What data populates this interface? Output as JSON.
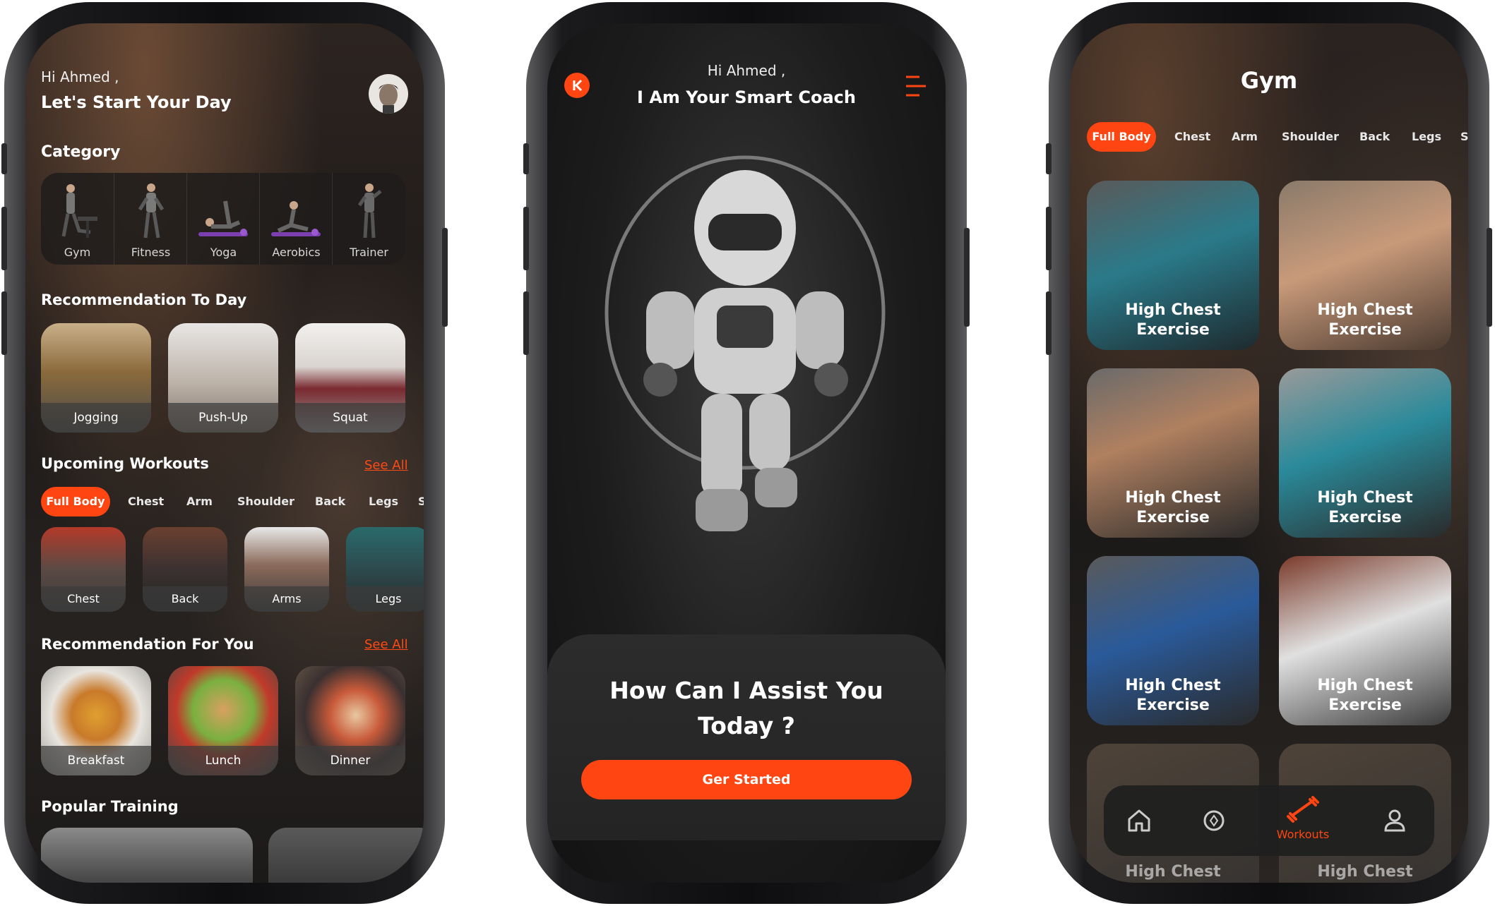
{
  "home": {
    "greeting": "Hi Ahmed ,",
    "subtitle": "Let's Start Your Day",
    "category_title": "Category",
    "categories": [
      {
        "label": "Gym",
        "icon": "gym-figure-icon"
      },
      {
        "label": "Fitness",
        "icon": "fitness-figure-icon"
      },
      {
        "label": "Yoga",
        "icon": "yoga-figure-icon"
      },
      {
        "label": "Aerobics",
        "icon": "aerobics-figure-icon"
      },
      {
        "label": "Trainer",
        "icon": "trainer-figure-icon"
      }
    ],
    "recommendation_today_title": "Recommendation To Day",
    "recommendations_today": [
      "Jogging",
      "Push-Up",
      "Squat"
    ],
    "upcoming_title": "Upcoming Workouts",
    "see_all": "See All",
    "tabs": [
      "Full Body",
      "Chest",
      "Arm",
      "Shoulder",
      "Back",
      "Legs",
      "S"
    ],
    "active_tab": "Full Body",
    "workouts": [
      "Chest",
      "Back",
      "Arms",
      "Legs"
    ],
    "recommendation_you_title": "Recommendation For You",
    "meals": [
      "Breakfast",
      "Lunch",
      "Dinner"
    ],
    "popular_title": "Popular Training"
  },
  "coach": {
    "greeting": "Hi Ahmed ,",
    "title": "I Am Your Smart Coach",
    "assist_line1": "How Can I Assist You",
    "assist_line2": "Today ?",
    "cta": "Ger Started"
  },
  "gym": {
    "title": "Gym",
    "tabs": [
      "Full Body",
      "Chest",
      "Arm",
      "Shoulder",
      "Back",
      "Legs",
      "S"
    ],
    "card_line1": "High Chest",
    "card_line2": "Exercise",
    "nav": {
      "workouts_label": "Workouts"
    }
  },
  "colors": {
    "accent": "#ff4512",
    "background": "#1c1a19"
  }
}
